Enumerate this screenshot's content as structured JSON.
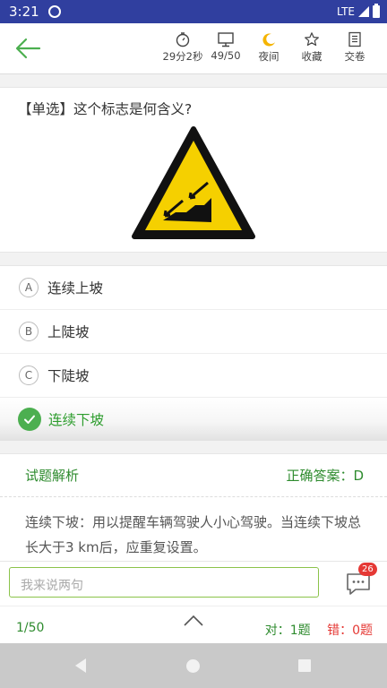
{
  "status_bar": {
    "time": "3:21",
    "network": "LTE"
  },
  "toolbar": {
    "timer": "29分2秒",
    "progress": "49/50",
    "night": "夜间",
    "favorite": "收藏",
    "submit": "交卷"
  },
  "question": {
    "text": "【单选】这个标志是何含义?",
    "sign_icon": "continuous-downhill-sign"
  },
  "options": [
    {
      "letter": "A",
      "text": "连续上坡"
    },
    {
      "letter": "B",
      "text": "上陡坡"
    },
    {
      "letter": "C",
      "text": "下陡坡"
    },
    {
      "letter": "D",
      "text": "连续下坡",
      "selected": true
    }
  ],
  "analysis": {
    "title": "试题解析",
    "answer": "正确答案：D",
    "body": "连续下坡：用以提醒车辆驾驶人小心驾驶。当连续下坡总长大于3 km后，应重复设置。"
  },
  "comment": {
    "placeholder": "我来说两句",
    "badge": "26"
  },
  "footer": {
    "page": "1/50",
    "right": "对：1题",
    "wrong": "错：0题"
  },
  "colors": {
    "accent": "#4caf50",
    "status_bar": "#303f9f",
    "error": "#e53935"
  }
}
